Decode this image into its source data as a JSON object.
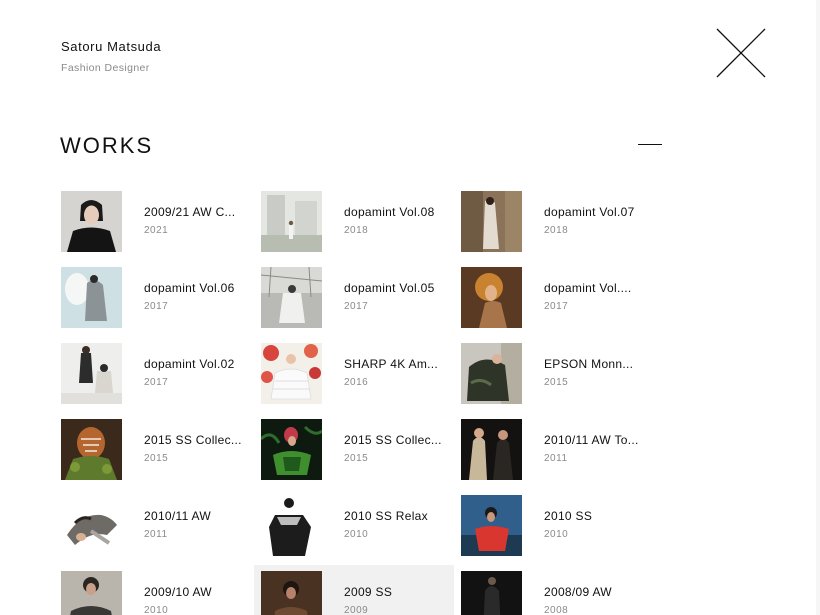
{
  "header": {
    "name": "Satoru Matsuda",
    "role": "Fashion Designer",
    "close_icon": "close-x-icon"
  },
  "section": {
    "title": "WORKS",
    "toggle_icon": "collapse-minus-icon"
  },
  "works": [
    {
      "title": "2009/21 AW C...",
      "year": "2021"
    },
    {
      "title": "dopamint Vol.08",
      "year": "2018"
    },
    {
      "title": "dopamint Vol.07",
      "year": "2018"
    },
    {
      "title": "dopamint Vol.06",
      "year": "2017"
    },
    {
      "title": "dopamint Vol.05",
      "year": "2017"
    },
    {
      "title": "dopamint Vol....",
      "year": "2017"
    },
    {
      "title": "dopamint Vol.02",
      "year": "2017"
    },
    {
      "title": "SHARP 4K Am...",
      "year": "2016"
    },
    {
      "title": "EPSON Monn...",
      "year": "2015"
    },
    {
      "title": "2015 SS Collec...",
      "year": "2015"
    },
    {
      "title": "2015 SS Collec...",
      "year": "2015"
    },
    {
      "title": "2010/11 AW To...",
      "year": "2011"
    },
    {
      "title": "2010/11 AW",
      "year": "2011"
    },
    {
      "title": "2010 SS Relax",
      "year": "2010"
    },
    {
      "title": "2010 SS",
      "year": "2010"
    },
    {
      "title": "2009/10 AW",
      "year": "2010"
    },
    {
      "title": "2009 SS",
      "year": "2009"
    },
    {
      "title": "2008/09 AW",
      "year": "2008"
    }
  ],
  "colors": {
    "text": "#111111",
    "muted": "#8a8a8a",
    "highlight": "#f1f1f1"
  }
}
